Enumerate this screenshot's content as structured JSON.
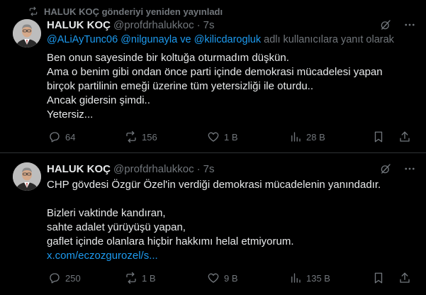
{
  "repost_notice": {
    "text": "HALUK KOÇ gönderiyi yeniden yayınladı",
    "icon": "repost-icon"
  },
  "tweets": [
    {
      "name": "HALUK KOÇ",
      "handle": "@profdrhalukkoc",
      "separator": "·",
      "time": "7s",
      "reply_to": {
        "mention1": "@ALiAyTunc06",
        "mention2": "@nilgunayla ve @kilicdarogluk",
        "suffix": "adlı kullanıcılara yanıt olarak"
      },
      "body_lines": [
        "Ben onun sayesinde bir koltuğa oturmadım düşkün.",
        "Ama o benim gibi ondan önce parti içinde demokrasi mücadelesi yapan",
        "birçok partilinin emeği üzerine tüm yetersizliği ile oturdu..",
        "Ancak gidersin şimdi..",
        "Yetersiz..."
      ],
      "actions": {
        "replies": "64",
        "reposts": "156",
        "likes": "1 B",
        "views": "28 B"
      }
    },
    {
      "name": "HALUK KOÇ",
      "handle": "@profdrhalukkoc",
      "separator": "·",
      "time": "7s",
      "body_lines": [
        "CHP gövdesi Özgür Özel'in verdiği demokrasi mücadelenin yanındadır.",
        "",
        "Bizleri vaktinde kandıran,",
        "sahte adalet yürüyüşü yapan,",
        "gaflet içinde olanlara hiçbir hakkımı helal etmiyorum."
      ],
      "link": "x.com/eczozgurozel/s...",
      "actions": {
        "replies": "250",
        "reposts": "1 B",
        "likes": "9 B",
        "views": "135 B"
      }
    }
  ],
  "colors": {
    "background": "#000000",
    "text": "#e7e9ea",
    "muted": "#71767b",
    "accent": "#1d9bf0",
    "divider": "#2f3336"
  }
}
